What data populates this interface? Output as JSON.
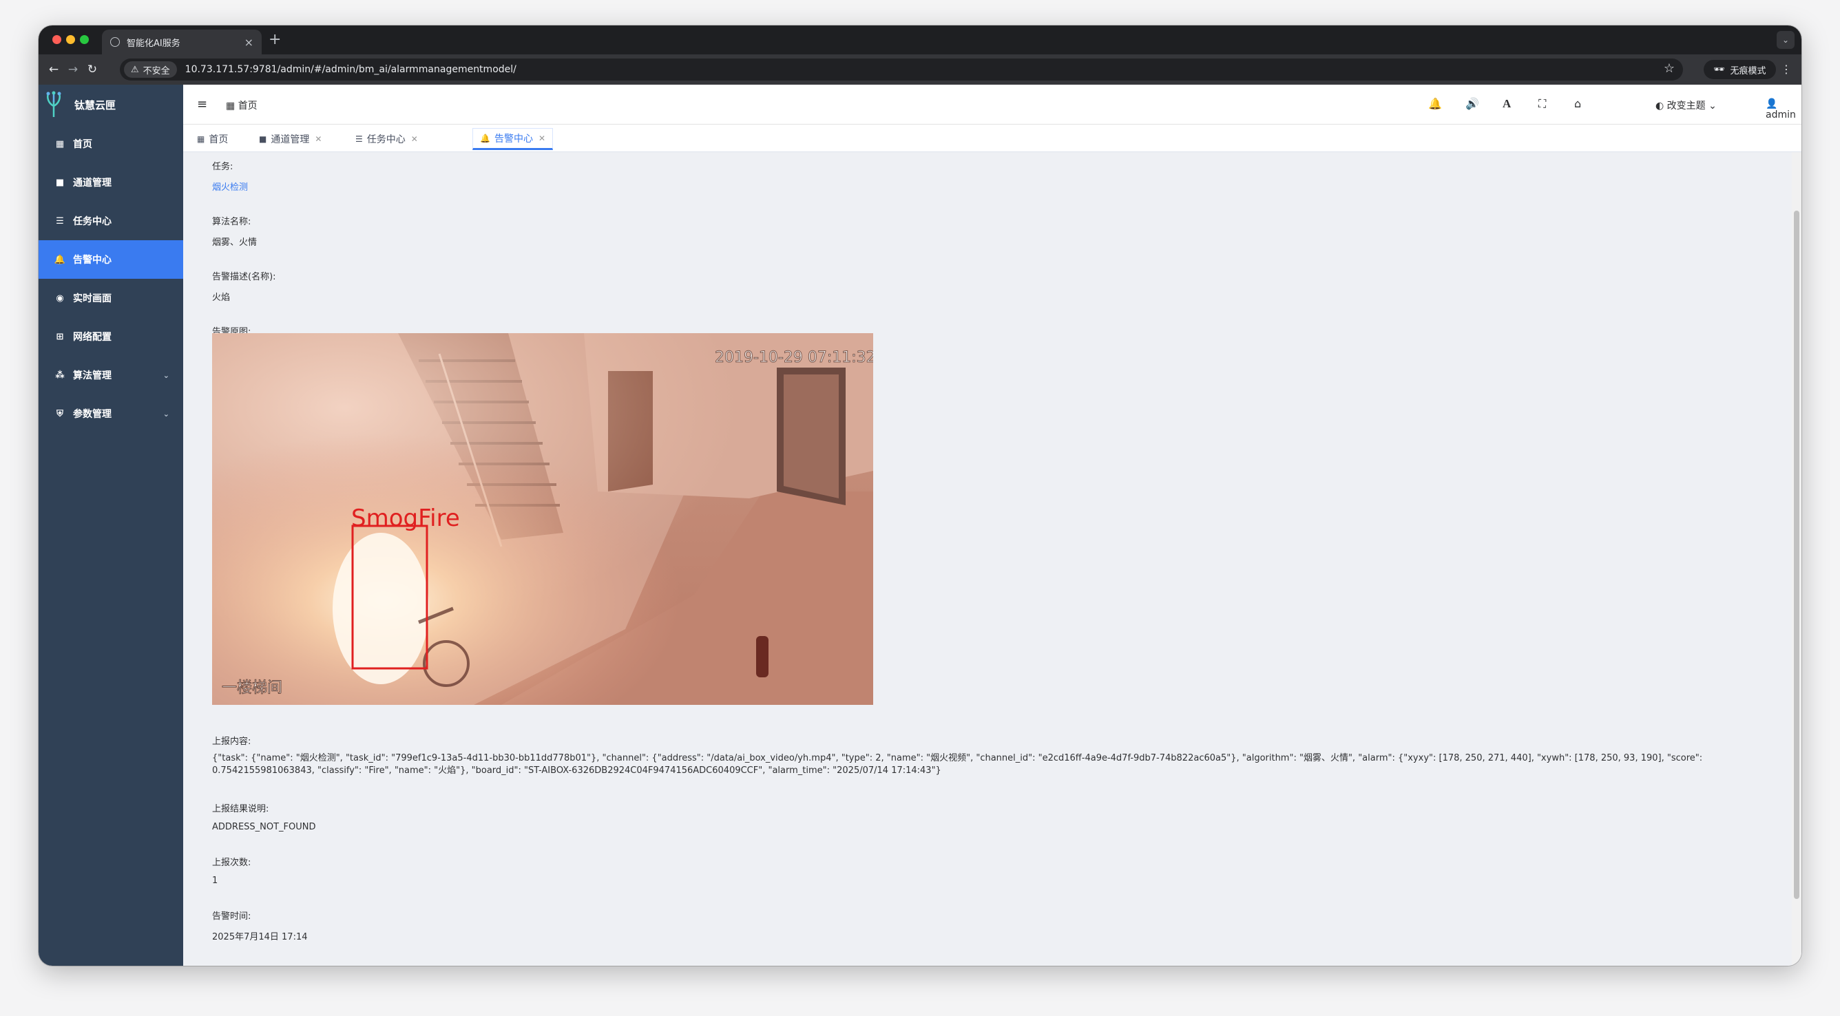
{
  "browser": {
    "tab_title": "智能化AI服务",
    "tab_close": "×",
    "new_tab": "+",
    "security_label": "不安全",
    "url": "10.73.171.57:9781/admin/#/admin/bm_ai/alarmmanagementmodel/",
    "incognito_label": "无痕模式"
  },
  "sidebar": {
    "brand": "钛慧云匣",
    "items": [
      {
        "label": "首页",
        "icon": "dashboard-icon"
      },
      {
        "label": "通道管理",
        "icon": "video-camera-icon"
      },
      {
        "label": "任务中心",
        "icon": "server-icon"
      },
      {
        "label": "告警中心",
        "icon": "bell-icon"
      },
      {
        "label": "实时画面",
        "icon": "eye-icon"
      },
      {
        "label": "网络配置",
        "icon": "network-icon"
      },
      {
        "label": "算法管理",
        "icon": "cubes-icon"
      },
      {
        "label": "参数管理",
        "icon": "shield-icon"
      }
    ]
  },
  "header": {
    "breadcrumb": "首页",
    "theme_label": "改变主题",
    "user": "admin"
  },
  "tags": [
    {
      "label": "首页"
    },
    {
      "label": "通道管理"
    },
    {
      "label": "任务中心"
    },
    {
      "label": "告警中心"
    }
  ],
  "detail": {
    "task_label": "任务:",
    "task_value": "烟火检测",
    "algorithm_label": "算法名称:",
    "algorithm_value": "烟雾、火情",
    "desc_label": "告警描述(名称):",
    "desc_value": "火焰",
    "image_label": "告警原图:",
    "image_timestamp": "2019-10-29 07:11:32",
    "image_box_label": "SmogFire",
    "image_watermark": "一楼梯间",
    "report_label": "上报内容:",
    "report_value": "{\"task\": {\"name\": \"烟火检测\", \"task_id\": \"799ef1c9-13a5-4d11-bb30-bb11dd778b01\"}, \"channel\": {\"address\": \"/data/ai_box_video/yh.mp4\", \"type\": 2, \"name\": \"烟火视频\", \"channel_id\": \"e2cd16ff-4a9e-4d7f-9db7-74b822ac60a5\"}, \"algorithm\": \"烟雾、火情\", \"alarm\": {\"xyxy\": [178, 250, 271, 440], \"xywh\": [178, 250, 93, 190], \"score\": 0.7542155981063843, \"classify\": \"Fire\", \"name\": \"火焰\"}, \"board_id\": \"ST-AIBOX-6326DB2924C04F9474156ADC60409CCF\", \"alarm_time\": \"2025/07/14 17:14:43\"}",
    "result_label": "上报结果说明:",
    "result_value": "ADDRESS_NOT_FOUND",
    "count_label": "上报次数:",
    "count_value": "1",
    "time_label": "告警时间:",
    "time_value": "2025年7月14日 17:14"
  },
  "colors": {
    "sidebar_bg": "#304156",
    "accent": "#3a7bf0",
    "bell": "#f56c6c",
    "sound": "#67c23a",
    "detection_box": "#e02020"
  }
}
